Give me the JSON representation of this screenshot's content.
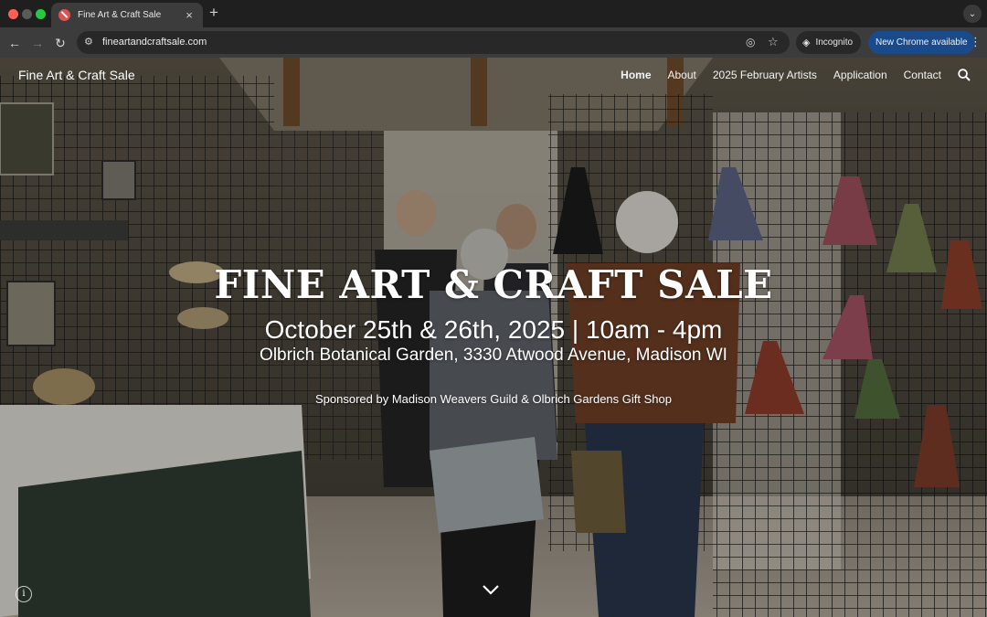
{
  "browser": {
    "tab_title": "Fine Art & Craft Sale",
    "tab_close": "×",
    "new_tab": "+",
    "tab_menu": "⌄",
    "back": "←",
    "forward": "→",
    "reload": "↻",
    "site_info": "⚙",
    "url": "fineartandcraftsale.com",
    "eye_off": "◎",
    "star": "☆",
    "incognito_icon": "◈",
    "incognito_label": "Incognito",
    "update_label": "New Chrome available",
    "menu": "⋮"
  },
  "site": {
    "title": "Fine Art & Craft Sale",
    "nav": [
      {
        "label": "Home"
      },
      {
        "label": "About"
      },
      {
        "label": "2025 February Artists"
      },
      {
        "label": "Application"
      },
      {
        "label": "Contact"
      }
    ]
  },
  "hero": {
    "title": "FINE ART & CRAFT SALE",
    "dates": "October 25th & 26th, 2025 | 10am - 4pm",
    "location": "Olbrich Botanical Garden, 3330 Atwood Avenue, Madison WI",
    "sponsor": "Sponsored by Madison Weavers Guild & Olbrich Gardens Gift Shop"
  },
  "footer": {
    "info": "i"
  }
}
